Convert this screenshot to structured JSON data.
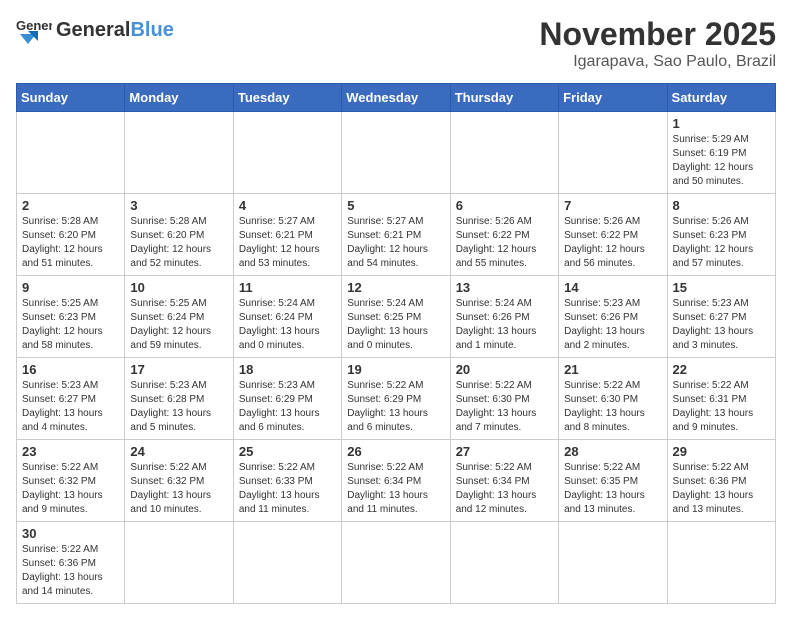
{
  "header": {
    "logo_general": "General",
    "logo_blue": "Blue",
    "title": "November 2025",
    "subtitle": "Igarapava, Sao Paulo, Brazil"
  },
  "weekdays": [
    "Sunday",
    "Monday",
    "Tuesday",
    "Wednesday",
    "Thursday",
    "Friday",
    "Saturday"
  ],
  "weeks": [
    [
      {
        "day": "",
        "info": ""
      },
      {
        "day": "",
        "info": ""
      },
      {
        "day": "",
        "info": ""
      },
      {
        "day": "",
        "info": ""
      },
      {
        "day": "",
        "info": ""
      },
      {
        "day": "",
        "info": ""
      },
      {
        "day": "1",
        "info": "Sunrise: 5:29 AM\nSunset: 6:19 PM\nDaylight: 12 hours\nand 50 minutes."
      }
    ],
    [
      {
        "day": "2",
        "info": "Sunrise: 5:28 AM\nSunset: 6:20 PM\nDaylight: 12 hours\nand 51 minutes."
      },
      {
        "day": "3",
        "info": "Sunrise: 5:28 AM\nSunset: 6:20 PM\nDaylight: 12 hours\nand 52 minutes."
      },
      {
        "day": "4",
        "info": "Sunrise: 5:27 AM\nSunset: 6:21 PM\nDaylight: 12 hours\nand 53 minutes."
      },
      {
        "day": "5",
        "info": "Sunrise: 5:27 AM\nSunset: 6:21 PM\nDaylight: 12 hours\nand 54 minutes."
      },
      {
        "day": "6",
        "info": "Sunrise: 5:26 AM\nSunset: 6:22 PM\nDaylight: 12 hours\nand 55 minutes."
      },
      {
        "day": "7",
        "info": "Sunrise: 5:26 AM\nSunset: 6:22 PM\nDaylight: 12 hours\nand 56 minutes."
      },
      {
        "day": "8",
        "info": "Sunrise: 5:26 AM\nSunset: 6:23 PM\nDaylight: 12 hours\nand 57 minutes."
      }
    ],
    [
      {
        "day": "9",
        "info": "Sunrise: 5:25 AM\nSunset: 6:23 PM\nDaylight: 12 hours\nand 58 minutes."
      },
      {
        "day": "10",
        "info": "Sunrise: 5:25 AM\nSunset: 6:24 PM\nDaylight: 12 hours\nand 59 minutes."
      },
      {
        "day": "11",
        "info": "Sunrise: 5:24 AM\nSunset: 6:24 PM\nDaylight: 13 hours\nand 0 minutes."
      },
      {
        "day": "12",
        "info": "Sunrise: 5:24 AM\nSunset: 6:25 PM\nDaylight: 13 hours\nand 0 minutes."
      },
      {
        "day": "13",
        "info": "Sunrise: 5:24 AM\nSunset: 6:26 PM\nDaylight: 13 hours\nand 1 minute."
      },
      {
        "day": "14",
        "info": "Sunrise: 5:23 AM\nSunset: 6:26 PM\nDaylight: 13 hours\nand 2 minutes."
      },
      {
        "day": "15",
        "info": "Sunrise: 5:23 AM\nSunset: 6:27 PM\nDaylight: 13 hours\nand 3 minutes."
      }
    ],
    [
      {
        "day": "16",
        "info": "Sunrise: 5:23 AM\nSunset: 6:27 PM\nDaylight: 13 hours\nand 4 minutes."
      },
      {
        "day": "17",
        "info": "Sunrise: 5:23 AM\nSunset: 6:28 PM\nDaylight: 13 hours\nand 5 minutes."
      },
      {
        "day": "18",
        "info": "Sunrise: 5:23 AM\nSunset: 6:29 PM\nDaylight: 13 hours\nand 6 minutes."
      },
      {
        "day": "19",
        "info": "Sunrise: 5:22 AM\nSunset: 6:29 PM\nDaylight: 13 hours\nand 6 minutes."
      },
      {
        "day": "20",
        "info": "Sunrise: 5:22 AM\nSunset: 6:30 PM\nDaylight: 13 hours\nand 7 minutes."
      },
      {
        "day": "21",
        "info": "Sunrise: 5:22 AM\nSunset: 6:30 PM\nDaylight: 13 hours\nand 8 minutes."
      },
      {
        "day": "22",
        "info": "Sunrise: 5:22 AM\nSunset: 6:31 PM\nDaylight: 13 hours\nand 9 minutes."
      }
    ],
    [
      {
        "day": "23",
        "info": "Sunrise: 5:22 AM\nSunset: 6:32 PM\nDaylight: 13 hours\nand 9 minutes."
      },
      {
        "day": "24",
        "info": "Sunrise: 5:22 AM\nSunset: 6:32 PM\nDaylight: 13 hours\nand 10 minutes."
      },
      {
        "day": "25",
        "info": "Sunrise: 5:22 AM\nSunset: 6:33 PM\nDaylight: 13 hours\nand 11 minutes."
      },
      {
        "day": "26",
        "info": "Sunrise: 5:22 AM\nSunset: 6:34 PM\nDaylight: 13 hours\nand 11 minutes."
      },
      {
        "day": "27",
        "info": "Sunrise: 5:22 AM\nSunset: 6:34 PM\nDaylight: 13 hours\nand 12 minutes."
      },
      {
        "day": "28",
        "info": "Sunrise: 5:22 AM\nSunset: 6:35 PM\nDaylight: 13 hours\nand 13 minutes."
      },
      {
        "day": "29",
        "info": "Sunrise: 5:22 AM\nSunset: 6:36 PM\nDaylight: 13 hours\nand 13 minutes."
      }
    ],
    [
      {
        "day": "30",
        "info": "Sunrise: 5:22 AM\nSunset: 6:36 PM\nDaylight: 13 hours\nand 14 minutes."
      },
      {
        "day": "",
        "info": ""
      },
      {
        "day": "",
        "info": ""
      },
      {
        "day": "",
        "info": ""
      },
      {
        "day": "",
        "info": ""
      },
      {
        "day": "",
        "info": ""
      },
      {
        "day": "",
        "info": ""
      }
    ]
  ]
}
